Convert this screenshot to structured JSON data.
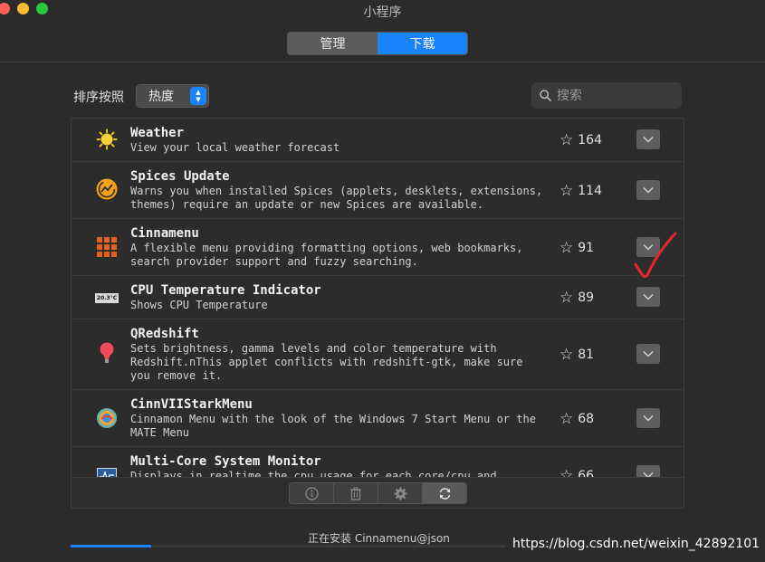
{
  "window": {
    "title": "小程序"
  },
  "tabs": {
    "manage": "管理",
    "download": "下载"
  },
  "sort": {
    "label": "排序按照",
    "selected": "热度"
  },
  "search": {
    "placeholder": "搜索"
  },
  "applets": [
    {
      "name": "Weather",
      "description": "View your local weather forecast",
      "stars": "164",
      "icon": "sun-icon"
    },
    {
      "name": "Spices Update",
      "description": "Warns you when installed Spices (applets, desklets, extensions, themes) require an update or new Spices are available.",
      "stars": "114",
      "icon": "spices-update-icon"
    },
    {
      "name": "Cinnamenu",
      "description": "A flexible menu providing formatting options, web bookmarks, search provider support and fuzzy searching.",
      "stars": "91",
      "icon": "grid-menu-icon"
    },
    {
      "name": "CPU Temperature Indicator",
      "description": "Shows CPU Temperature",
      "stars": "89",
      "icon": "temperature-display-icon",
      "icon_text": "20.3°C"
    },
    {
      "name": "QRedshift",
      "description": "Sets brightness, gamma levels and color temperature with Redshift.nThis applet conflicts with redshift-gtk, make sure you remove it.",
      "stars": "81",
      "icon": "bulb-icon"
    },
    {
      "name": "CinnVIIStarkMenu",
      "description": "Cinnamon Menu with the look of the Windows 7 Start Menu or the MATE Menu",
      "stars": "68",
      "icon": "orb-icon"
    },
    {
      "name": "Multi-Core System Monitor",
      "description": "Displays in realtime the cpu usage for each core/cpu and overall",
      "stars": "66",
      "icon": "monitor-icon"
    }
  ],
  "toolbar": {
    "info": "info-icon",
    "remove": "trash-icon",
    "settings": "gear-icon",
    "refresh": "refresh-icon"
  },
  "status": {
    "text": "正在安装 Cinnamenu@json",
    "progress": 0.185
  },
  "watermark": "https://blog.csdn.net/weixin_42892101",
  "colors": {
    "accent": "#1a82fb",
    "background": "#2b2b2b",
    "annotation": "#e5282d"
  }
}
